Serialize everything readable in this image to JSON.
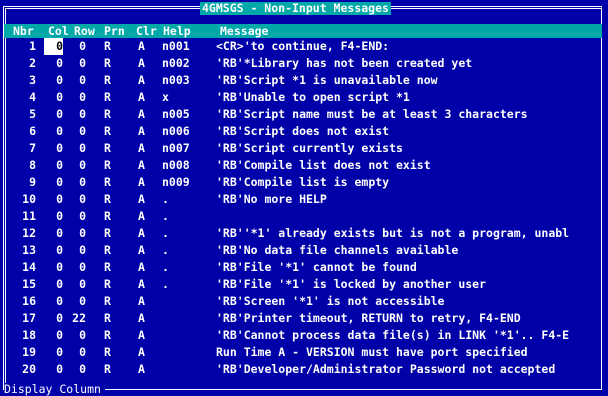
{
  "window": {
    "title": "4GMSGS - Non-Input Messages"
  },
  "columns": {
    "nbr": "Nbr",
    "col": "Col",
    "row": "Row",
    "prn": "Prn",
    "clr": "Clr",
    "help": "Help",
    "message": "Message"
  },
  "rows": [
    {
      "nbr": "1",
      "col": "0",
      "row": "0",
      "prn": "R",
      "clr": "A",
      "help": "n001",
      "message": "<CR>'to continue, F4-END:",
      "selected": true
    },
    {
      "nbr": "2",
      "col": "0",
      "row": "0",
      "prn": "R",
      "clr": "A",
      "help": "n002",
      "message": "'RB'*Library has not been created yet"
    },
    {
      "nbr": "3",
      "col": "0",
      "row": "0",
      "prn": "R",
      "clr": "A",
      "help": "n003",
      "message": "'RB'Script *1 is unavailable now"
    },
    {
      "nbr": "4",
      "col": "0",
      "row": "0",
      "prn": "R",
      "clr": "A",
      "help": "x",
      "message": "'RB'Unable to open script *1"
    },
    {
      "nbr": "5",
      "col": "0",
      "row": "0",
      "prn": "R",
      "clr": "A",
      "help": "n005",
      "message": "'RB'Script name must be at least 3 characters"
    },
    {
      "nbr": "6",
      "col": "0",
      "row": "0",
      "prn": "R",
      "clr": "A",
      "help": "n006",
      "message": "'RB'Script does not exist"
    },
    {
      "nbr": "7",
      "col": "0",
      "row": "0",
      "prn": "R",
      "clr": "A",
      "help": "n007",
      "message": "'RB'Script currently exists"
    },
    {
      "nbr": "8",
      "col": "0",
      "row": "0",
      "prn": "R",
      "clr": "A",
      "help": "n008",
      "message": "'RB'Compile list does not exist"
    },
    {
      "nbr": "9",
      "col": "0",
      "row": "0",
      "prn": "R",
      "clr": "A",
      "help": "n009",
      "message": "'RB'Compile list is empty"
    },
    {
      "nbr": "10",
      "col": "0",
      "row": "0",
      "prn": "R",
      "clr": "A",
      "help": ".",
      "message": "'RB'No more HELP"
    },
    {
      "nbr": "11",
      "col": "0",
      "row": "0",
      "prn": "R",
      "clr": "A",
      "help": ".",
      "message": ""
    },
    {
      "nbr": "12",
      "col": "0",
      "row": "0",
      "prn": "R",
      "clr": "A",
      "help": ".",
      "message": "'RB''*1' already exists but is not a program, unabl"
    },
    {
      "nbr": "13",
      "col": "0",
      "row": "0",
      "prn": "R",
      "clr": "A",
      "help": ".",
      "message": "'RB'No data file channels available"
    },
    {
      "nbr": "14",
      "col": "0",
      "row": "0",
      "prn": "R",
      "clr": "A",
      "help": ".",
      "message": "'RB'File '*1' cannot be found"
    },
    {
      "nbr": "15",
      "col": "0",
      "row": "0",
      "prn": "R",
      "clr": "A",
      "help": ".",
      "message": "'RB'File '*1' is locked by another user"
    },
    {
      "nbr": "16",
      "col": "0",
      "row": "0",
      "prn": "R",
      "clr": "A",
      "help": "",
      "message": "'RB'Screen '*1' is not accessible"
    },
    {
      "nbr": "17",
      "col": "0",
      "row": "22",
      "prn": "R",
      "clr": "A",
      "help": "",
      "message": "'RB'Printer timeout, RETURN to retry, F4-END"
    },
    {
      "nbr": "18",
      "col": "0",
      "row": "0",
      "prn": "R",
      "clr": "A",
      "help": "",
      "message": "'RB'Cannot process data file(s) in LINK '*1'.. F4-E"
    },
    {
      "nbr": "19",
      "col": "0",
      "row": "0",
      "prn": "R",
      "clr": "A",
      "help": "",
      "message": "Run Time A - VERSION must have port specified"
    },
    {
      "nbr": "20",
      "col": "0",
      "row": "0",
      "prn": "R",
      "clr": "A",
      "help": "",
      "message": "'RB'Developer/Administrator Password not accepted"
    }
  ],
  "status": {
    "prompt": "Display Column"
  },
  "colors": {
    "background": "#0000a8",
    "header": "#00a8a8",
    "text": "#ffffff",
    "highlight": "#ffffff"
  }
}
